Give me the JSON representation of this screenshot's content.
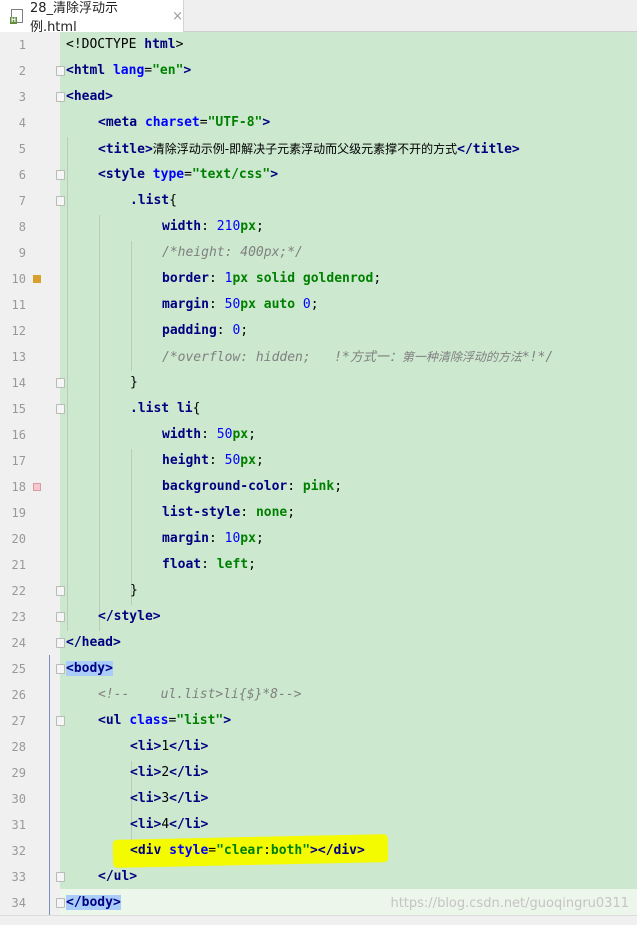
{
  "tab": {
    "title": "28_清除浮动示例.html",
    "close_icon": "×",
    "file_icon": "html-file-icon"
  },
  "lines": [
    {
      "n": "1"
    },
    {
      "n": "2"
    },
    {
      "n": "3"
    },
    {
      "n": "4"
    },
    {
      "n": "5"
    },
    {
      "n": "6"
    },
    {
      "n": "7"
    },
    {
      "n": "8"
    },
    {
      "n": "9"
    },
    {
      "n": "10"
    },
    {
      "n": "11"
    },
    {
      "n": "12"
    },
    {
      "n": "13"
    },
    {
      "n": "14"
    },
    {
      "n": "15"
    },
    {
      "n": "16"
    },
    {
      "n": "17"
    },
    {
      "n": "18"
    },
    {
      "n": "19"
    },
    {
      "n": "20"
    },
    {
      "n": "21"
    },
    {
      "n": "22"
    },
    {
      "n": "23"
    },
    {
      "n": "24"
    },
    {
      "n": "25"
    },
    {
      "n": "26"
    },
    {
      "n": "27"
    },
    {
      "n": "28"
    },
    {
      "n": "29"
    },
    {
      "n": "30"
    },
    {
      "n": "31"
    },
    {
      "n": "32"
    },
    {
      "n": "33"
    },
    {
      "n": "34"
    }
  ],
  "code": {
    "l1": [
      "<!DOCTYPE ",
      "html",
      ">"
    ],
    "l2": [
      "<html ",
      "lang",
      "=",
      "\"en\"",
      ">"
    ],
    "l3": [
      "<head>"
    ],
    "l4": [
      "<meta ",
      "charset",
      "=",
      "\"UTF-8\"",
      ">"
    ],
    "l5": [
      "<title>",
      "清除浮动示例-即解决子元素浮动而父级元素撑不开的方式",
      "</title>"
    ],
    "l6": [
      "<style ",
      "type",
      "=",
      "\"text/css\"",
      ">"
    ],
    "l7": [
      ".list",
      "{"
    ],
    "l8": [
      "width",
      ": ",
      "210",
      "px",
      ";"
    ],
    "l9": [
      "/*height: 400px;*/"
    ],
    "l10": [
      "border",
      ": ",
      "1",
      "px solid goldenrod",
      ";"
    ],
    "l11": [
      "margin",
      ": ",
      "50",
      "px auto ",
      "0",
      ";"
    ],
    "l12": [
      "padding",
      ": ",
      "0",
      ";"
    ],
    "l13": [
      "/*overflow: hidden;   !*方式一：",
      "第一种清除浮动的方法",
      "*!*/"
    ],
    "l14": [
      "}"
    ],
    "l15": [
      ".list li",
      "{"
    ],
    "l16": [
      "width",
      ": ",
      "50",
      "px",
      ";"
    ],
    "l17": [
      "height",
      ": ",
      "50",
      "px",
      ";"
    ],
    "l18": [
      "background-color",
      ": ",
      "pink",
      ";"
    ],
    "l19": [
      "list-style",
      ": ",
      "none",
      ";"
    ],
    "l20": [
      "margin",
      ": ",
      "10",
      "px",
      ";"
    ],
    "l21": [
      "float",
      ": ",
      "left",
      ";"
    ],
    "l22": [
      "}"
    ],
    "l23": [
      "</style>"
    ],
    "l24": [
      "</head>"
    ],
    "l25": [
      "<body>"
    ],
    "l26": [
      "<!--    ul.list>li{$}*8-->"
    ],
    "l27": [
      "<ul ",
      "class",
      "=",
      "\"list\"",
      ">"
    ],
    "l28": [
      "<li>",
      "1",
      "</li>"
    ],
    "l29": [
      "<li>",
      "2",
      "</li>"
    ],
    "l30": [
      "<li>",
      "3",
      "</li>"
    ],
    "l31": [
      "<li>",
      "4",
      "</li>"
    ],
    "l32": [
      "<div ",
      "style",
      "=",
      "\"clear",
      ":",
      "both",
      "\"",
      ">",
      "</div>"
    ],
    "l33": [
      "</ul>"
    ],
    "l34": [
      "</body>"
    ]
  },
  "watermark": "https://blog.csdn.net/guoqingru0311",
  "colors": {
    "code_background": "#cce8cf",
    "gutter_background": "#f0f0f0",
    "tag": "#000080",
    "attribute": "#0000ff",
    "string": "#008000",
    "comment": "#808080",
    "highlighter": "#f4fa00",
    "body_tag_highlight": "#a9cdf8"
  }
}
